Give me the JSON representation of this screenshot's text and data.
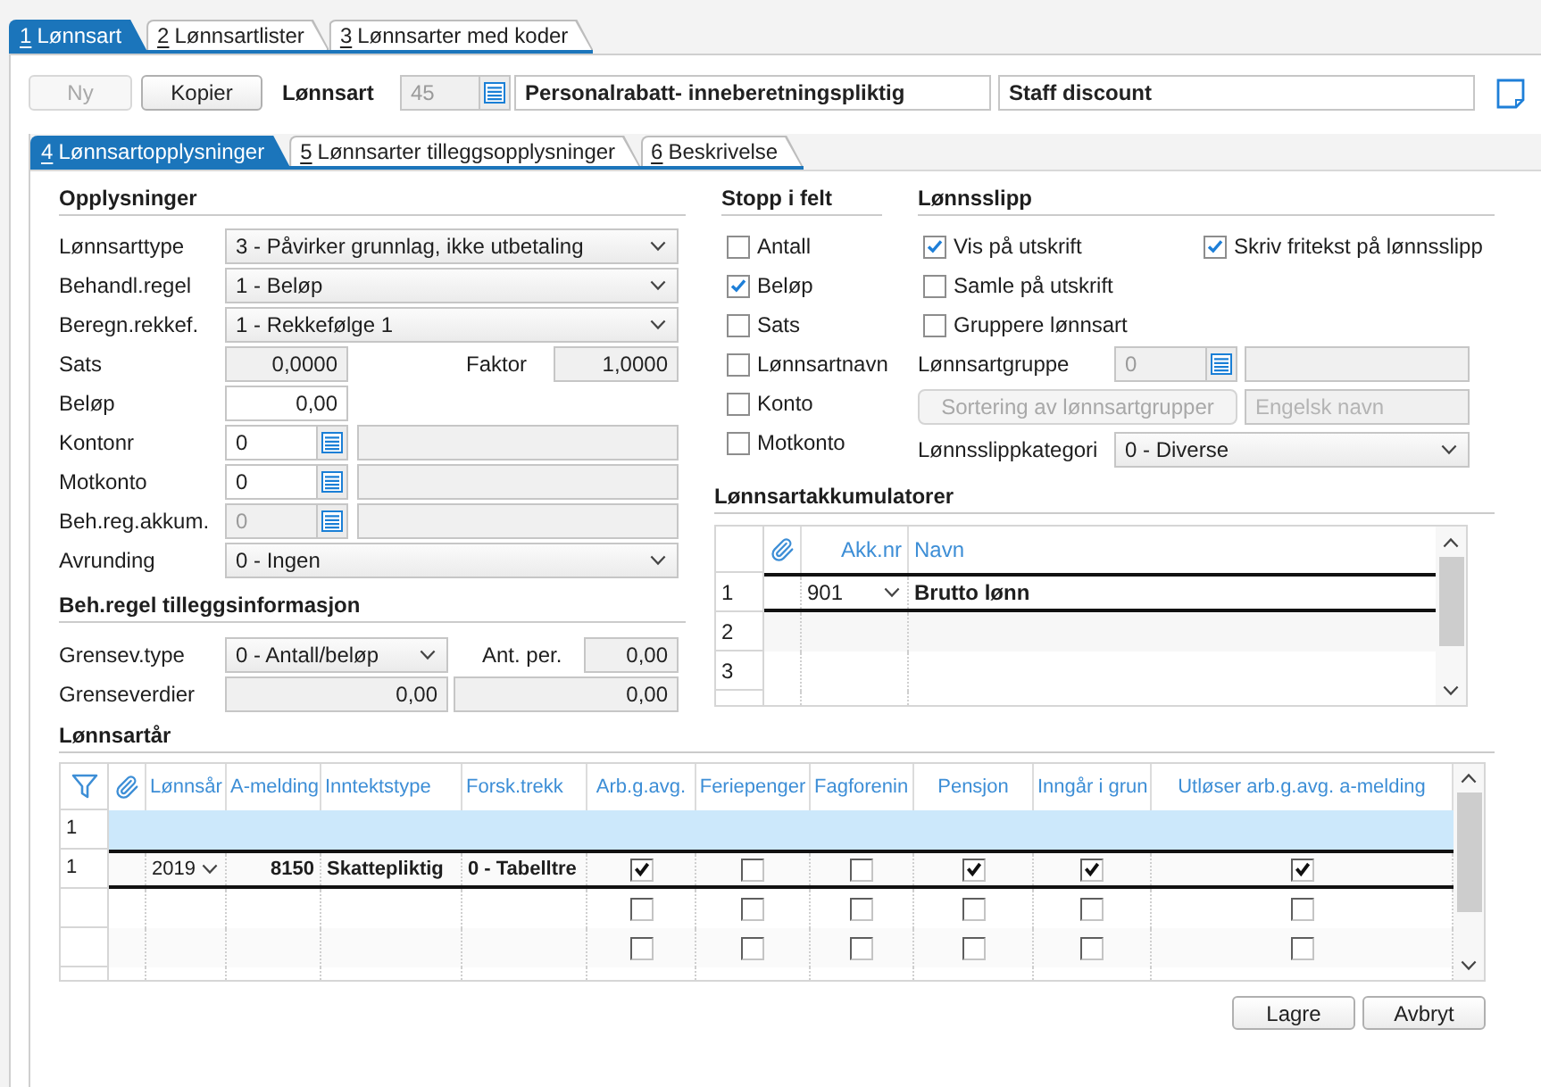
{
  "main_tabs": [
    {
      "key": "1",
      "label": "Lønnsart",
      "selected": true
    },
    {
      "key": "2",
      "label": "Lønnsartlister",
      "selected": false
    },
    {
      "key": "3",
      "label": "Lønnsarter med koder",
      "selected": false
    }
  ],
  "toolbar": {
    "buttons": [
      {
        "label": "Ny",
        "disabled": true
      },
      {
        "label": "Kopier",
        "disabled": false
      }
    ],
    "record_label": "Lønnsart",
    "number": "45",
    "name": "Personalrabatt- inneberetningspliktig",
    "english_name": "Staff discount"
  },
  "sub_tabs": [
    {
      "key": "4",
      "label": "Lønnsartopplysninger",
      "selected": true
    },
    {
      "key": "5",
      "label": "Lønnsarter tilleggsopplysninger",
      "selected": false
    },
    {
      "key": "6",
      "label": "Beskrivelse",
      "selected": false
    }
  ],
  "opplysninger": {
    "title": "Opplysninger",
    "rows": [
      {
        "kind": "dropdown",
        "label": "Lønnsarttype",
        "value": "3 - Påvirker grunnlag, ikke utbetaling"
      },
      {
        "kind": "dropdown",
        "label": "Behandl.regel",
        "value": "1 - Beløp"
      },
      {
        "kind": "dropdown",
        "label": "Beregn.rekkef.",
        "value": "1 - Rekkefølge 1"
      },
      {
        "kind": "pair",
        "label": "Sats",
        "value": "0,0000",
        "readonly": true,
        "second_label": "Faktor",
        "second_value": "1,0000"
      },
      {
        "kind": "number",
        "label": "Beløp",
        "value": "0,00",
        "readonly": false
      },
      {
        "kind": "lookup",
        "label": "Kontonr",
        "value": "0",
        "disabled": false
      },
      {
        "kind": "lookup",
        "label": "Motkonto",
        "value": "0",
        "disabled": false
      },
      {
        "kind": "lookup",
        "label": "Beh.reg.akkum.",
        "value": "0",
        "disabled": true
      },
      {
        "kind": "dropdown",
        "label": "Avrunding",
        "value": "0 - Ingen"
      }
    ]
  },
  "tilleggsinformasjon": {
    "title": "Beh.regel tilleggsinformasjon",
    "grensev_type": {
      "label": "Grensev.type",
      "value": "0 - Antall/beløp"
    },
    "ant_per": {
      "label": "Ant. per.",
      "value": "0,00"
    },
    "grenseverdier": {
      "label": "Grenseverdier",
      "values": [
        "0,00",
        "0,00"
      ]
    }
  },
  "stopp_i_felt": {
    "title": "Stopp i felt",
    "items": [
      {
        "label": "Antall",
        "checked": false
      },
      {
        "label": "Beløp",
        "checked": true
      },
      {
        "label": "Sats",
        "checked": false
      },
      {
        "label": "Lønnsartnavn",
        "checked": false
      },
      {
        "label": "Konto",
        "checked": false
      },
      {
        "label": "Motkonto",
        "checked": false
      }
    ]
  },
  "lonnsslipp": {
    "title": "Lønnsslipp",
    "checkboxes": [
      {
        "label": "Vis på utskrift",
        "checked": true
      },
      {
        "label": "Skriv fritekst på lønnsslipp",
        "checked": true
      },
      {
        "label": "Samle på utskrift",
        "checked": false
      },
      {
        "label": "Gruppere lønnsart",
        "checked": false
      }
    ],
    "lonnsartgruppe": {
      "label": "Lønnsartgruppe",
      "value": "0",
      "disabled": true
    },
    "sort_button": {
      "label": "Sortering av lønnsartgrupper",
      "disabled": true
    },
    "english_name_field": {
      "placeholder": "Engelsk navn"
    },
    "kategori": {
      "label": "Lønnsslippkategori",
      "value": "0 - Diverse"
    }
  },
  "akkumulatorer": {
    "title": "Lønnsartakkumulatorer",
    "columns": [
      "Akk.nr",
      "Navn"
    ],
    "rows": [
      {
        "number": "1",
        "akk_nr": "901",
        "navn": "Brutto lønn",
        "current": true
      },
      {
        "number": "2",
        "current": false
      },
      {
        "number": "3",
        "current": false
      }
    ]
  },
  "lonnsartar": {
    "title": "Lønnsartår",
    "columns": [
      "Lønnsår",
      "A-melding",
      "Inntektstype",
      "Forsk.trekk",
      "Arb.g.avg.",
      "Feriepenger",
      "Fagforenin",
      "Pensjon",
      "Inngår i grun",
      "Utløser arb.g.avg. a-melding"
    ],
    "rows": [
      {
        "kind": "highlighted",
        "number": "1"
      },
      {
        "kind": "data",
        "number": "1",
        "current": true,
        "lonnsar": "2019",
        "a_melding": "8150",
        "inntektstype": "Skattepliktig",
        "forsk_trekk": "0 - Tabelltre",
        "checks": [
          true,
          false,
          false,
          true,
          true,
          true
        ]
      },
      {
        "kind": "data",
        "current": false,
        "checks": [
          false,
          false,
          false,
          false,
          false,
          false
        ]
      },
      {
        "kind": "data",
        "current": false,
        "checks": [
          false,
          false,
          false,
          false,
          false,
          false
        ]
      }
    ]
  },
  "footer_buttons": [
    {
      "label": "Lagre"
    },
    {
      "label": "Avbryt"
    }
  ]
}
